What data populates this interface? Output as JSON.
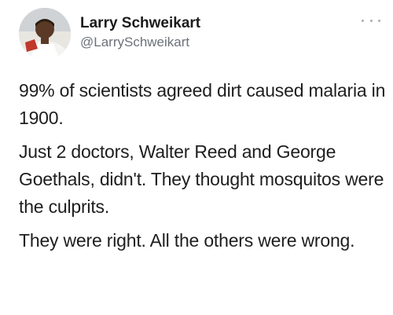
{
  "tweet": {
    "author": {
      "display_name": "Larry Schweikart",
      "handle": "@LarrySchweikart",
      "avatar_icon": "person-photo"
    },
    "more_icon": "ellipsis-icon",
    "paragraphs": [
      "99% of scientists agreed dirt caused malaria in 1900.",
      "Just 2 doctors, Walter Reed and George Goethals, didn't. They thought mosquitos were the culprits.",
      "They were right. All the others were wrong."
    ]
  }
}
